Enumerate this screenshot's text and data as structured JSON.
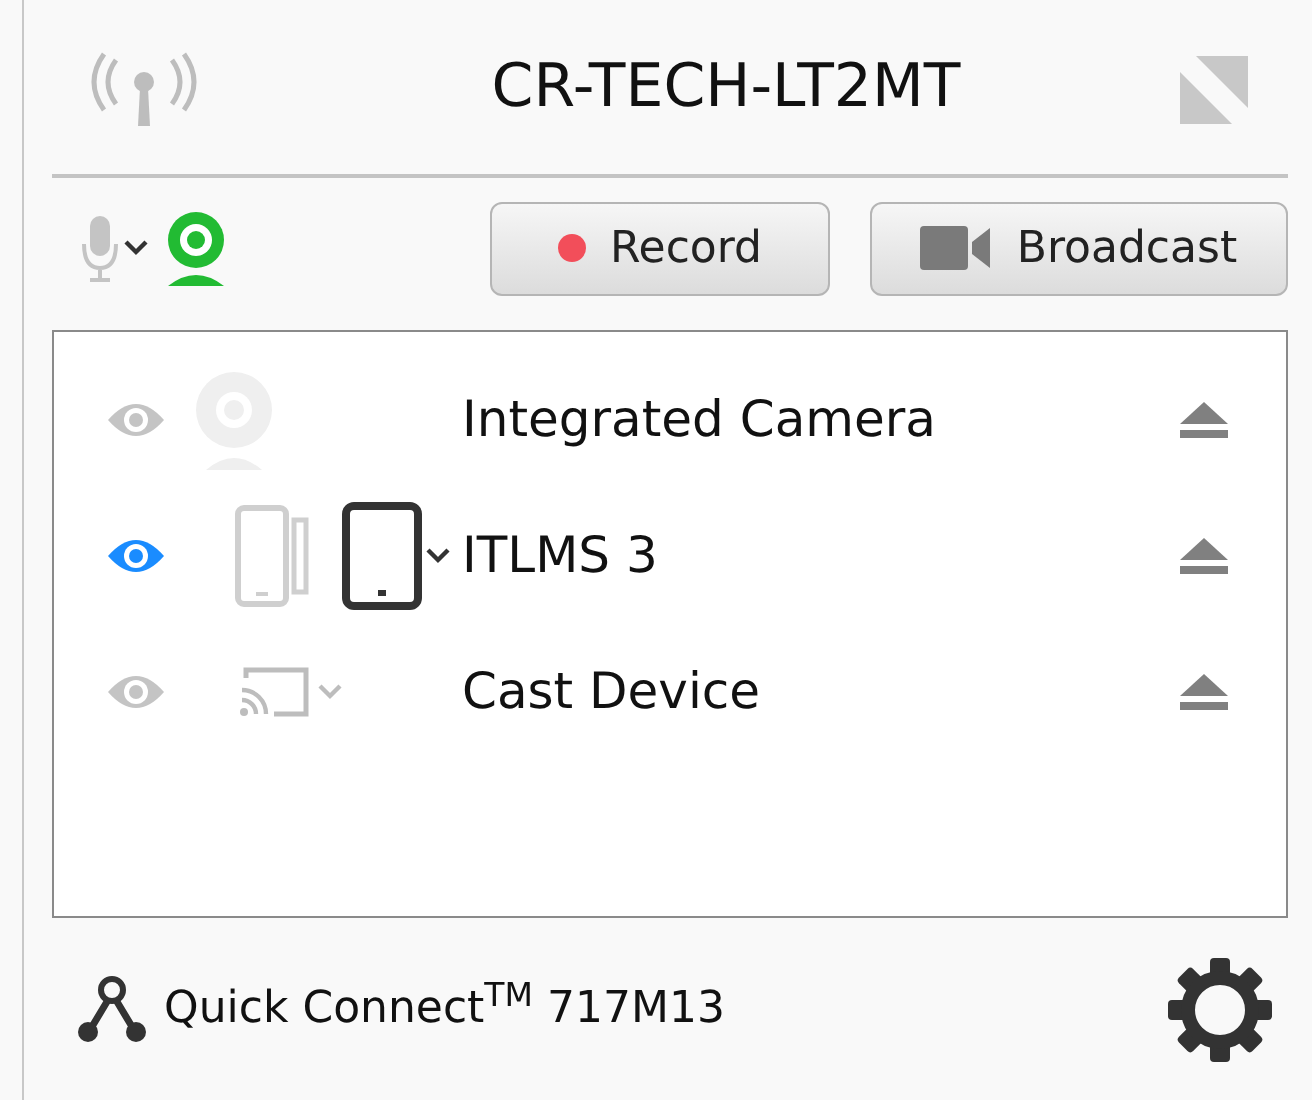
{
  "title": "CR-TECH-LT2MT",
  "buttons": [
    {
      "kind": "record",
      "label": "Record"
    },
    {
      "kind": "broadcast",
      "label": "Broadcast"
    }
  ],
  "devices": [
    {
      "name": "Integrated Camera",
      "visible": false,
      "kind": "camera"
    },
    {
      "name": "ITLMS 3",
      "visible": true,
      "kind": "tablet"
    },
    {
      "name": "Cast Device",
      "visible": false,
      "kind": "cast"
    }
  ],
  "footer": {
    "quick_connect": "Quick Connect$^{TM}$ 717M13"
  }
}
